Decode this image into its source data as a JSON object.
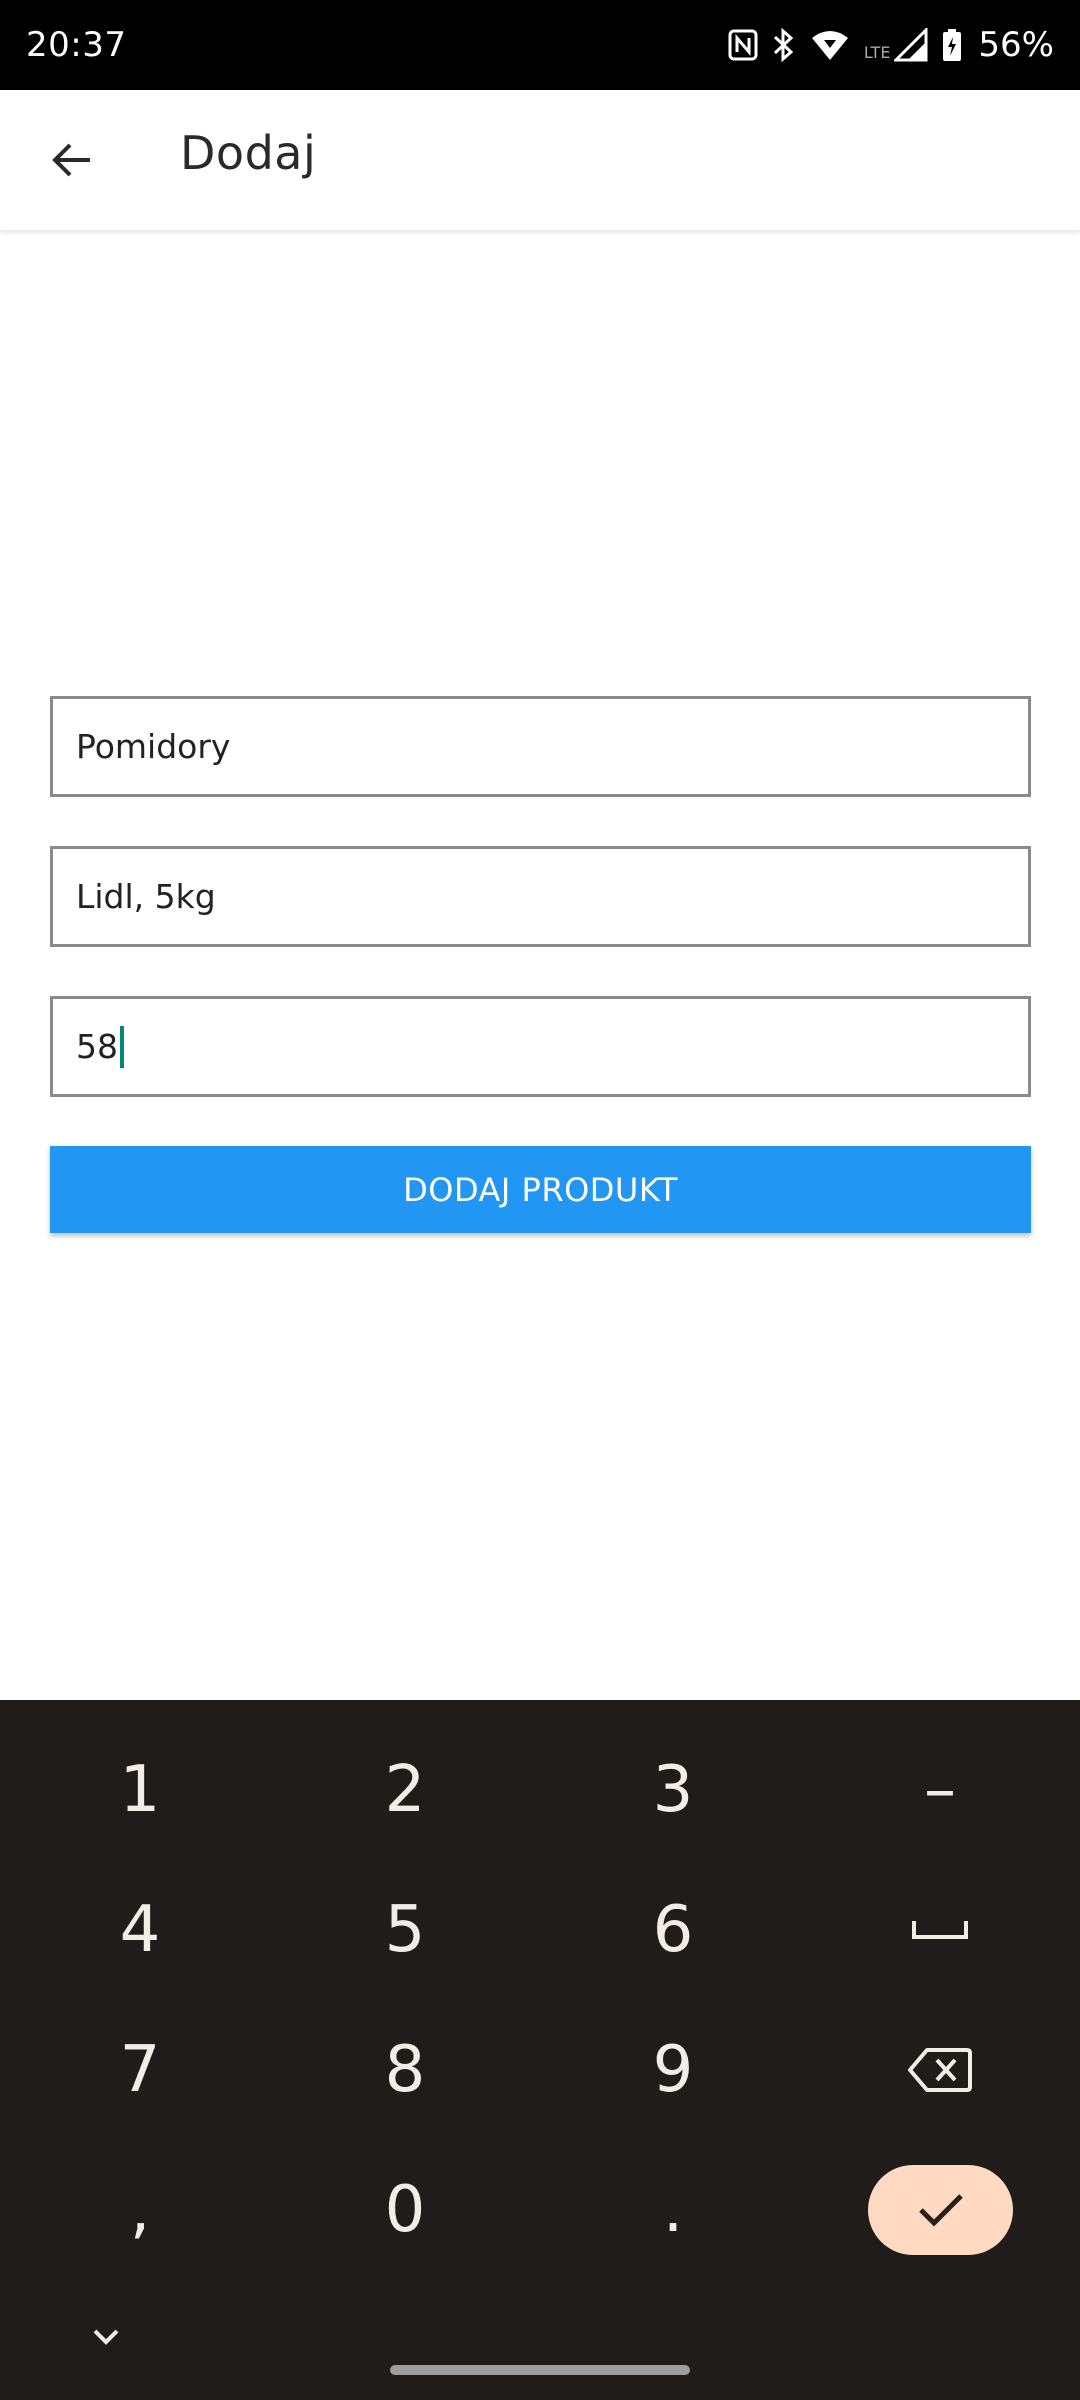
{
  "status_bar": {
    "time": "20:37",
    "network_type": "LTE",
    "battery_percent": "56%",
    "icons": [
      "nfc-icon",
      "bluetooth-icon",
      "wifi-icon",
      "signal-icon",
      "battery-icon"
    ]
  },
  "app_bar": {
    "title": "Dodaj",
    "back_icon": "arrow-back-icon"
  },
  "form": {
    "name_value": "Pomidory",
    "description_value": "Lidl, 5kg",
    "price_value": "58",
    "submit_label": "DODAJ PRODUKT"
  },
  "keyboard": {
    "row1": [
      "1",
      "2",
      "3",
      "–"
    ],
    "row2": [
      "4",
      "5",
      "6",
      "space"
    ],
    "row3": [
      "7",
      "8",
      "9",
      "backspace"
    ],
    "row4": [
      ",",
      "0",
      ".",
      "done"
    ]
  },
  "colors": {
    "accent": "#2196f3",
    "caret": "#00897b",
    "keyboard_bg": "#201c19",
    "confirm_key_bg": "#ffd9c2"
  }
}
